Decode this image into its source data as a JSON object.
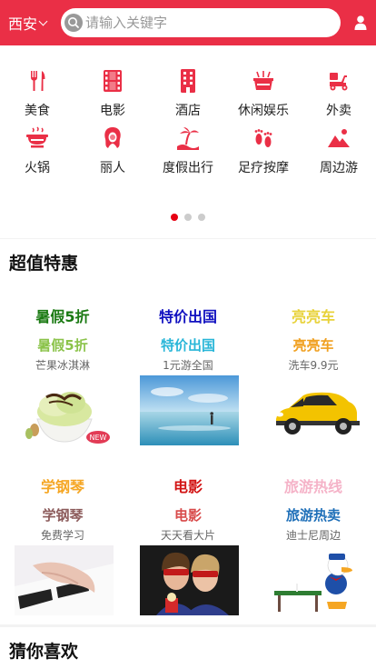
{
  "header": {
    "city": "西安",
    "search_placeholder": "请输入关键字",
    "bg_color": "#ea2f46"
  },
  "categories": [
    {
      "label": "美食",
      "icon": "fork-knife-icon"
    },
    {
      "label": "电影",
      "icon": "film-icon"
    },
    {
      "label": "酒店",
      "icon": "hotel-icon"
    },
    {
      "label": "休闲娱乐",
      "icon": "leisure-icon"
    },
    {
      "label": "外卖",
      "icon": "delivery-scooter-icon"
    },
    {
      "label": "火锅",
      "icon": "hotpot-icon"
    },
    {
      "label": "丽人",
      "icon": "beauty-icon"
    },
    {
      "label": "度假出行",
      "icon": "island-vacation-icon"
    },
    {
      "label": "足疗按摩",
      "icon": "footprints-icon"
    },
    {
      "label": "周边游",
      "icon": "mountain-icon"
    }
  ],
  "carousel": {
    "pages": 3,
    "active": 0,
    "active_color": "#e60012"
  },
  "sections": {
    "deals_title": "超值特惠",
    "guess_title": "猜你喜欢"
  },
  "deals": [
    {
      "t1": "暑假5折",
      "t1_color": "#1a7a12",
      "t2": "暑假5折",
      "t2_color": "#8bc34a",
      "t3": "芒果冰淇淋",
      "image": "ice-cream-image",
      "badge": "NEW"
    },
    {
      "t1": "特价出国",
      "t1_color": "#1010c0",
      "t2": "特价出国",
      "t2_color": "#29b6d8",
      "t3": "1元游全国",
      "image": "beach-image"
    },
    {
      "t1": "亮亮车",
      "t1_color": "#e8d23a",
      "t2": "亮亮车",
      "t2_color": "#f0a020",
      "t3": "洗车9.9元",
      "image": "yellow-car-image"
    },
    {
      "t1": "学钢琴",
      "t1_color": "#f5a623",
      "t2": "学钢琴",
      "t2_color": "#8b5a5a",
      "t3": "免费学习",
      "image": "piano-image"
    },
    {
      "t1": "电影",
      "t1_color": "#d21414",
      "t2": "电影",
      "t2_color": "#d84a4a",
      "t3": "天天看大片",
      "image": "cinema-image"
    },
    {
      "t1": "旅游热线",
      "t1_color": "#f5b3c8",
      "t2": "旅游热卖",
      "t2_color": "#1e6fb8",
      "t3": "迪士尼周边",
      "image": "donald-duck-image"
    }
  ]
}
